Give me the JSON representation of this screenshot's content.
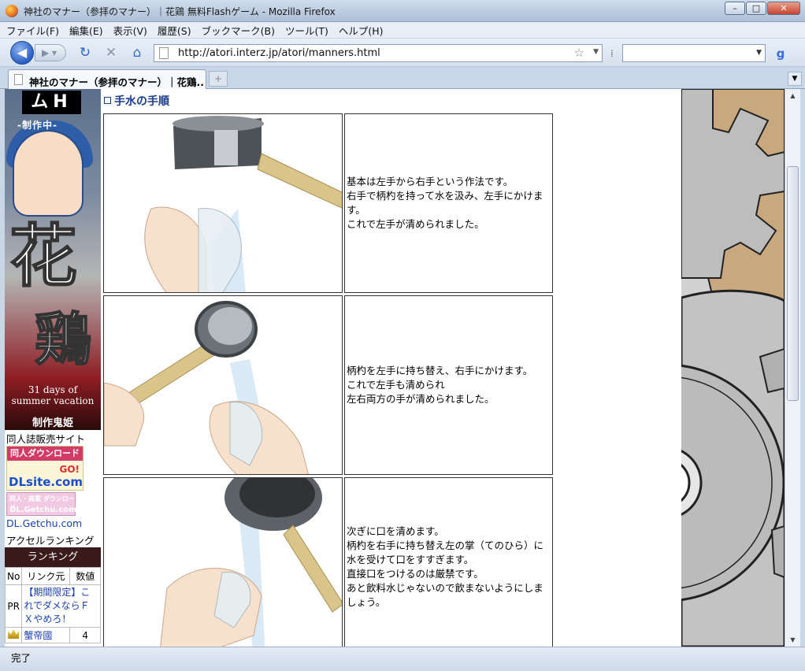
{
  "window": {
    "title": "神社のマナー（参拝のマナー）｜花鶏 無料Flashゲーム - Mozilla Firefox",
    "minimize_label": "–",
    "maximize_label": "□",
    "close_label": "✕"
  },
  "menu": [
    "ファイル(F)",
    "編集(E)",
    "表示(V)",
    "履歴(S)",
    "ブックマーク(B)",
    "ツール(T)",
    "ヘルプ(H)"
  ],
  "nav": {
    "back_icon": "back-arrow-icon",
    "url": "http://atori.interz.jp/atori/manners.html",
    "search_placeholder": ""
  },
  "tab": {
    "label": "神社のマナー（参拝のマナー）｜花鶏...",
    "new_tab_label": "+"
  },
  "sidebar": {
    "banner": {
      "logo": "ムH",
      "subtitle": "-制作中-",
      "kanji_top": "花",
      "kanji_bottom": "鶏",
      "tagline_1": "31 days of",
      "tagline_2": "summer vacation",
      "maker": "制作鬼姫"
    },
    "doujin_label": "同人誌販売サイト",
    "dlsite": {
      "top": "同人ダウンロード",
      "go": "GO!",
      "brand": "DLsite.com"
    },
    "getchu_banner": {
      "small": "同人・商業 ダウンロード",
      "big": "DL.Getchu.com"
    },
    "getchu_link": "DL.Getchu.com",
    "access_ranking": "アクセルランキング",
    "ranking": {
      "title": "ランキング",
      "headers": [
        "No",
        "リンク元",
        "数値"
      ],
      "pr_label": "PR",
      "pr_text": "【期間限定】これでダメならＦＸやめろ！",
      "first_name": "蟹帝國",
      "first_value": "4"
    }
  },
  "main": {
    "section_title": "手水の手順",
    "steps": [
      {
        "lines": [
          "基本は左手から右手という作法です。",
          "右手で柄杓を持って水を汲み、左手にかけます。",
          "これで左手が清められました。"
        ]
      },
      {
        "lines": [
          "柄杓を左手に持ち替え、右手にかけます。",
          "これで左手も清められ",
          "左右両方の手が清められました。"
        ]
      },
      {
        "lines": [
          "次ぎに口を清めます。",
          "柄杓を右手に持ち替え左の掌（てのひら）に水を受けて口をすすぎます。",
          "直接口をつけるのは厳禁です。",
          "あと飲料水じゃないので飲まないようにしましょう。"
        ]
      }
    ]
  },
  "status": {
    "text": "完了"
  }
}
